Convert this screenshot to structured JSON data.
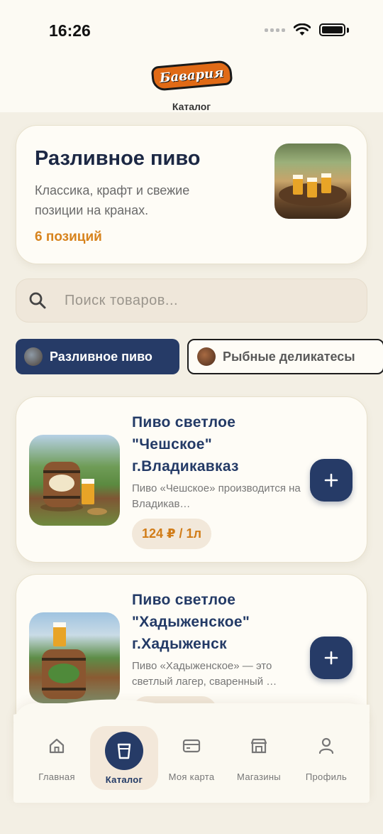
{
  "status_bar": {
    "time": "16:26"
  },
  "header": {
    "logo_text": "Бавария",
    "title": "Каталог"
  },
  "hero": {
    "title": "Разливное пиво",
    "subtitle": "Классика, крафт и свежие позиции на кранах.",
    "count": "6 позиций"
  },
  "search": {
    "placeholder": "Поиск товаров..."
  },
  "categories": [
    {
      "label": "Разливное пиво",
      "active": true
    },
    {
      "label": "Рыбные деликатесы",
      "active": false
    }
  ],
  "products": [
    {
      "name": "Пиво светлое \"Чешское\" г.Владикавказ",
      "description": "Пиво «Чешское» производится на Владикав…",
      "price": "124 ₽ / 1л"
    },
    {
      "name": "Пиво светлое \"Хадыженское\" г.Хадыженск",
      "description": "Пиво «Хадыженское» — это светлый лагер, сваренный …",
      "price": ""
    }
  ],
  "bottom_nav": [
    {
      "label": "Главная",
      "icon": "home-icon",
      "active": false
    },
    {
      "label": "Каталог",
      "icon": "cup-icon",
      "active": true
    },
    {
      "label": "Моя карта",
      "icon": "card-icon",
      "active": false
    },
    {
      "label": "Магазины",
      "icon": "store-icon",
      "active": false
    },
    {
      "label": "Профиль",
      "icon": "user-icon",
      "active": false
    }
  ],
  "colors": {
    "background": "#f3efe4",
    "primary": "#263b67",
    "accent": "#d7831d"
  }
}
